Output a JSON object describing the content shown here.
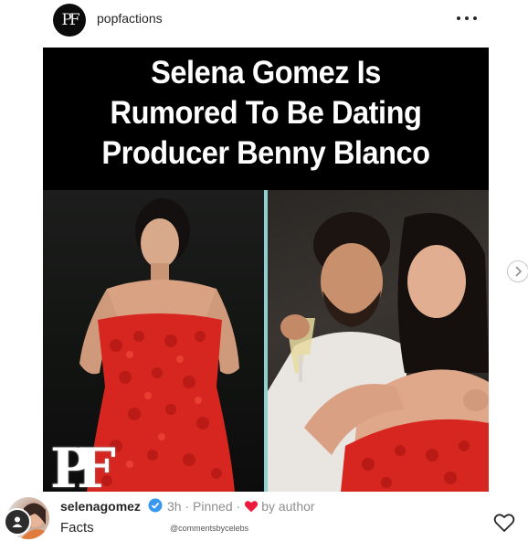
{
  "header": {
    "username": "popfactions",
    "avatar_monogram": "PF",
    "more_icon": "more-horizontal-icon"
  },
  "post": {
    "headline_lines": [
      "Selena Gomez Is",
      "Rumored To Be Dating",
      "Producer Benny Blanco"
    ],
    "watermark_text": "PF",
    "divider_color": "#8fcfd2",
    "next_icon": "chevron-right-icon"
  },
  "comment": {
    "username": "selenagomez",
    "verified_icon": "verified-badge-icon",
    "time": "3h",
    "pinned": "Pinned",
    "liked_by": "by author",
    "heart_color": "#ed1c3c",
    "text": "Facts",
    "credit": "@commentsbycelebs",
    "like_icon": "heart-outline-icon"
  }
}
